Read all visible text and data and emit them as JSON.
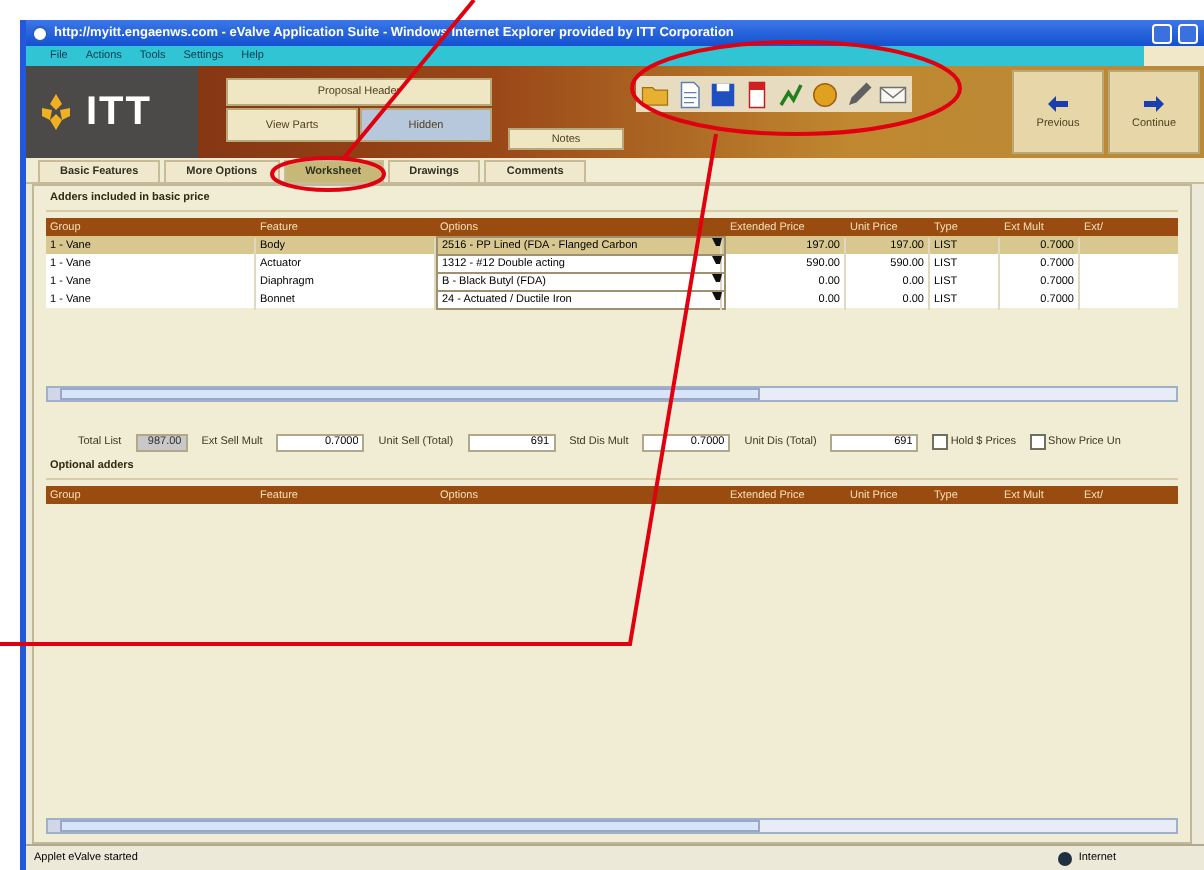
{
  "window": {
    "title": "http://myitt.engaenws.com - eValve Application Suite - Windows Internet Explorer provided by ITT Corporation"
  },
  "menu": [
    "File",
    "Actions",
    "Tools",
    "Settings",
    "Help"
  ],
  "header": {
    "logo": "ITT",
    "buttons": [
      {
        "label": "Proposal Header",
        "kind": "wide"
      },
      {
        "label": "View Parts",
        "kind": "plain"
      },
      {
        "label": "Hidden",
        "kind": "toggled"
      },
      {
        "label": "Notes",
        "kind": "plain"
      }
    ],
    "toolbar": [
      {
        "kind": "folder"
      },
      {
        "kind": "document"
      },
      {
        "kind": "save"
      },
      {
        "kind": "report"
      },
      {
        "kind": "chart"
      },
      {
        "kind": "coin"
      },
      {
        "kind": "pencil"
      },
      {
        "kind": "envelope"
      }
    ],
    "nav": [
      {
        "label": "Previous",
        "kind": "back"
      },
      {
        "label": "Continue",
        "kind": "forward"
      }
    ]
  },
  "tabs": [
    {
      "label": "Basic Features",
      "selected": false
    },
    {
      "label": "More Options",
      "selected": false
    },
    {
      "label": "Worksheet",
      "selected": true
    },
    {
      "label": "Drawings",
      "selected": false
    },
    {
      "label": "Comments",
      "selected": false
    }
  ],
  "included": {
    "title": "Adders included in basic price",
    "columns": [
      "Group",
      "Feature",
      "Options",
      "Extended Price",
      "Unit Price",
      "Type",
      "Ext Mult",
      "Ext/"
    ],
    "rows": [
      {
        "selected": true,
        "cells": [
          "1 - Vane",
          "Body",
          "2516 - PP Lined (FDA - Flanged Carbon",
          "197.00",
          "197.00",
          "LIST",
          "0.7000"
        ]
      },
      {
        "selected": false,
        "cells": [
          "1 - Vane",
          "Actuator",
          "1312 - #12 Double acting",
          "590.00",
          "590.00",
          "LIST",
          "0.7000"
        ]
      },
      {
        "selected": false,
        "cells": [
          "1 - Vane",
          "Diaphragm",
          "B - Black Butyl (FDA)",
          "0.00",
          "0.00",
          "LIST",
          "0.7000"
        ]
      },
      {
        "selected": false,
        "cells": [
          "1 - Vane",
          "Bonnet",
          "24 - Actuated / Ductile Iron",
          "0.00",
          "0.00",
          "LIST",
          "0.7000"
        ]
      }
    ]
  },
  "totals": [
    {
      "kind": "field",
      "label": "Total List",
      "value": "987.00",
      "disabled": true
    },
    {
      "kind": "field",
      "label": "Ext Sell Mult",
      "value": "0.7000",
      "disabled": false
    },
    {
      "kind": "field",
      "label": "Unit Sell (Total)",
      "value": "691",
      "disabled": false
    },
    {
      "kind": "field",
      "label": "Std Dis Mult",
      "value": "0.7000",
      "disabled": false
    },
    {
      "kind": "field",
      "label": "Unit Dis (Total)",
      "value": "691",
      "disabled": false
    },
    {
      "kind": "check",
      "label": "Hold $ Prices",
      "checked": false
    },
    {
      "kind": "check",
      "label": "Show Price Un",
      "checked": false
    }
  ],
  "optional": {
    "title": "Optional adders",
    "columns": [
      "Group",
      "Feature",
      "Options",
      "Extended Price",
      "Unit Price",
      "Type",
      "Ext Mult",
      "Ext/"
    ]
  },
  "status_bar": {
    "text": "Applet eValve started",
    "zone": "Internet"
  },
  "annotations": [
    {
      "kind": "ellipse"
    },
    {
      "kind": "ellipse"
    },
    {
      "kind": "line"
    },
    {
      "kind": "line"
    }
  ]
}
